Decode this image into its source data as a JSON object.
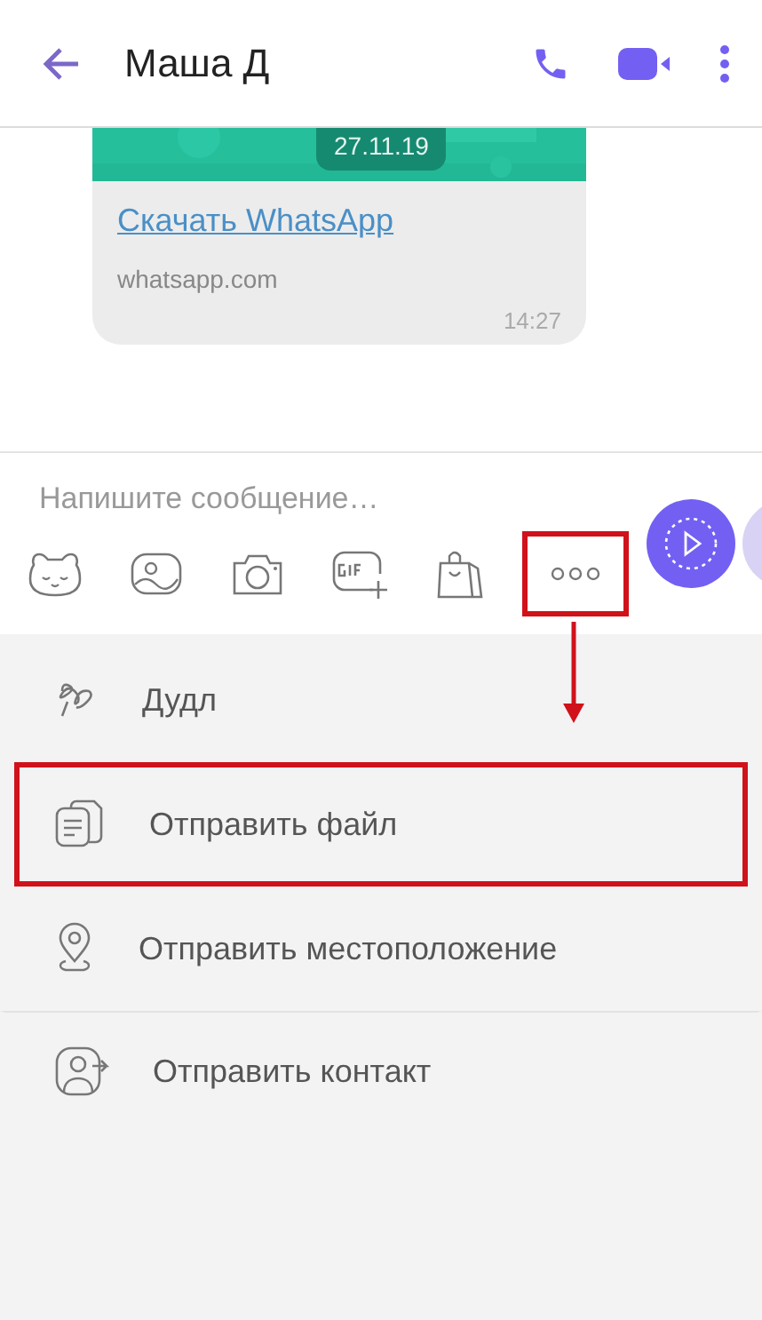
{
  "header": {
    "title": "Маша Д"
  },
  "message": {
    "date": "27.11.19",
    "link": "Скачать WhatsApp",
    "domain": "whatsapp.com",
    "time": "14:27"
  },
  "composer": {
    "placeholder": "Напишите сообщение…"
  },
  "toolbar": [
    {
      "kind": "sticker",
      "highlighted": false
    },
    {
      "kind": "gallery",
      "highlighted": false
    },
    {
      "kind": "camera",
      "highlighted": false
    },
    {
      "kind": "gif",
      "highlighted": false
    },
    {
      "kind": "shop",
      "highlighted": false
    },
    {
      "kind": "more",
      "highlighted": true
    }
  ],
  "menu": [
    {
      "kind": "doodle",
      "label": "Дудл",
      "highlighted": false
    },
    {
      "kind": "file",
      "label": "Отправить файл",
      "highlighted": true
    },
    {
      "kind": "location",
      "label": "Отправить местоположение",
      "highlighted": false
    },
    {
      "kind": "contact",
      "label": "Отправить контакт",
      "highlighted": false
    }
  ]
}
